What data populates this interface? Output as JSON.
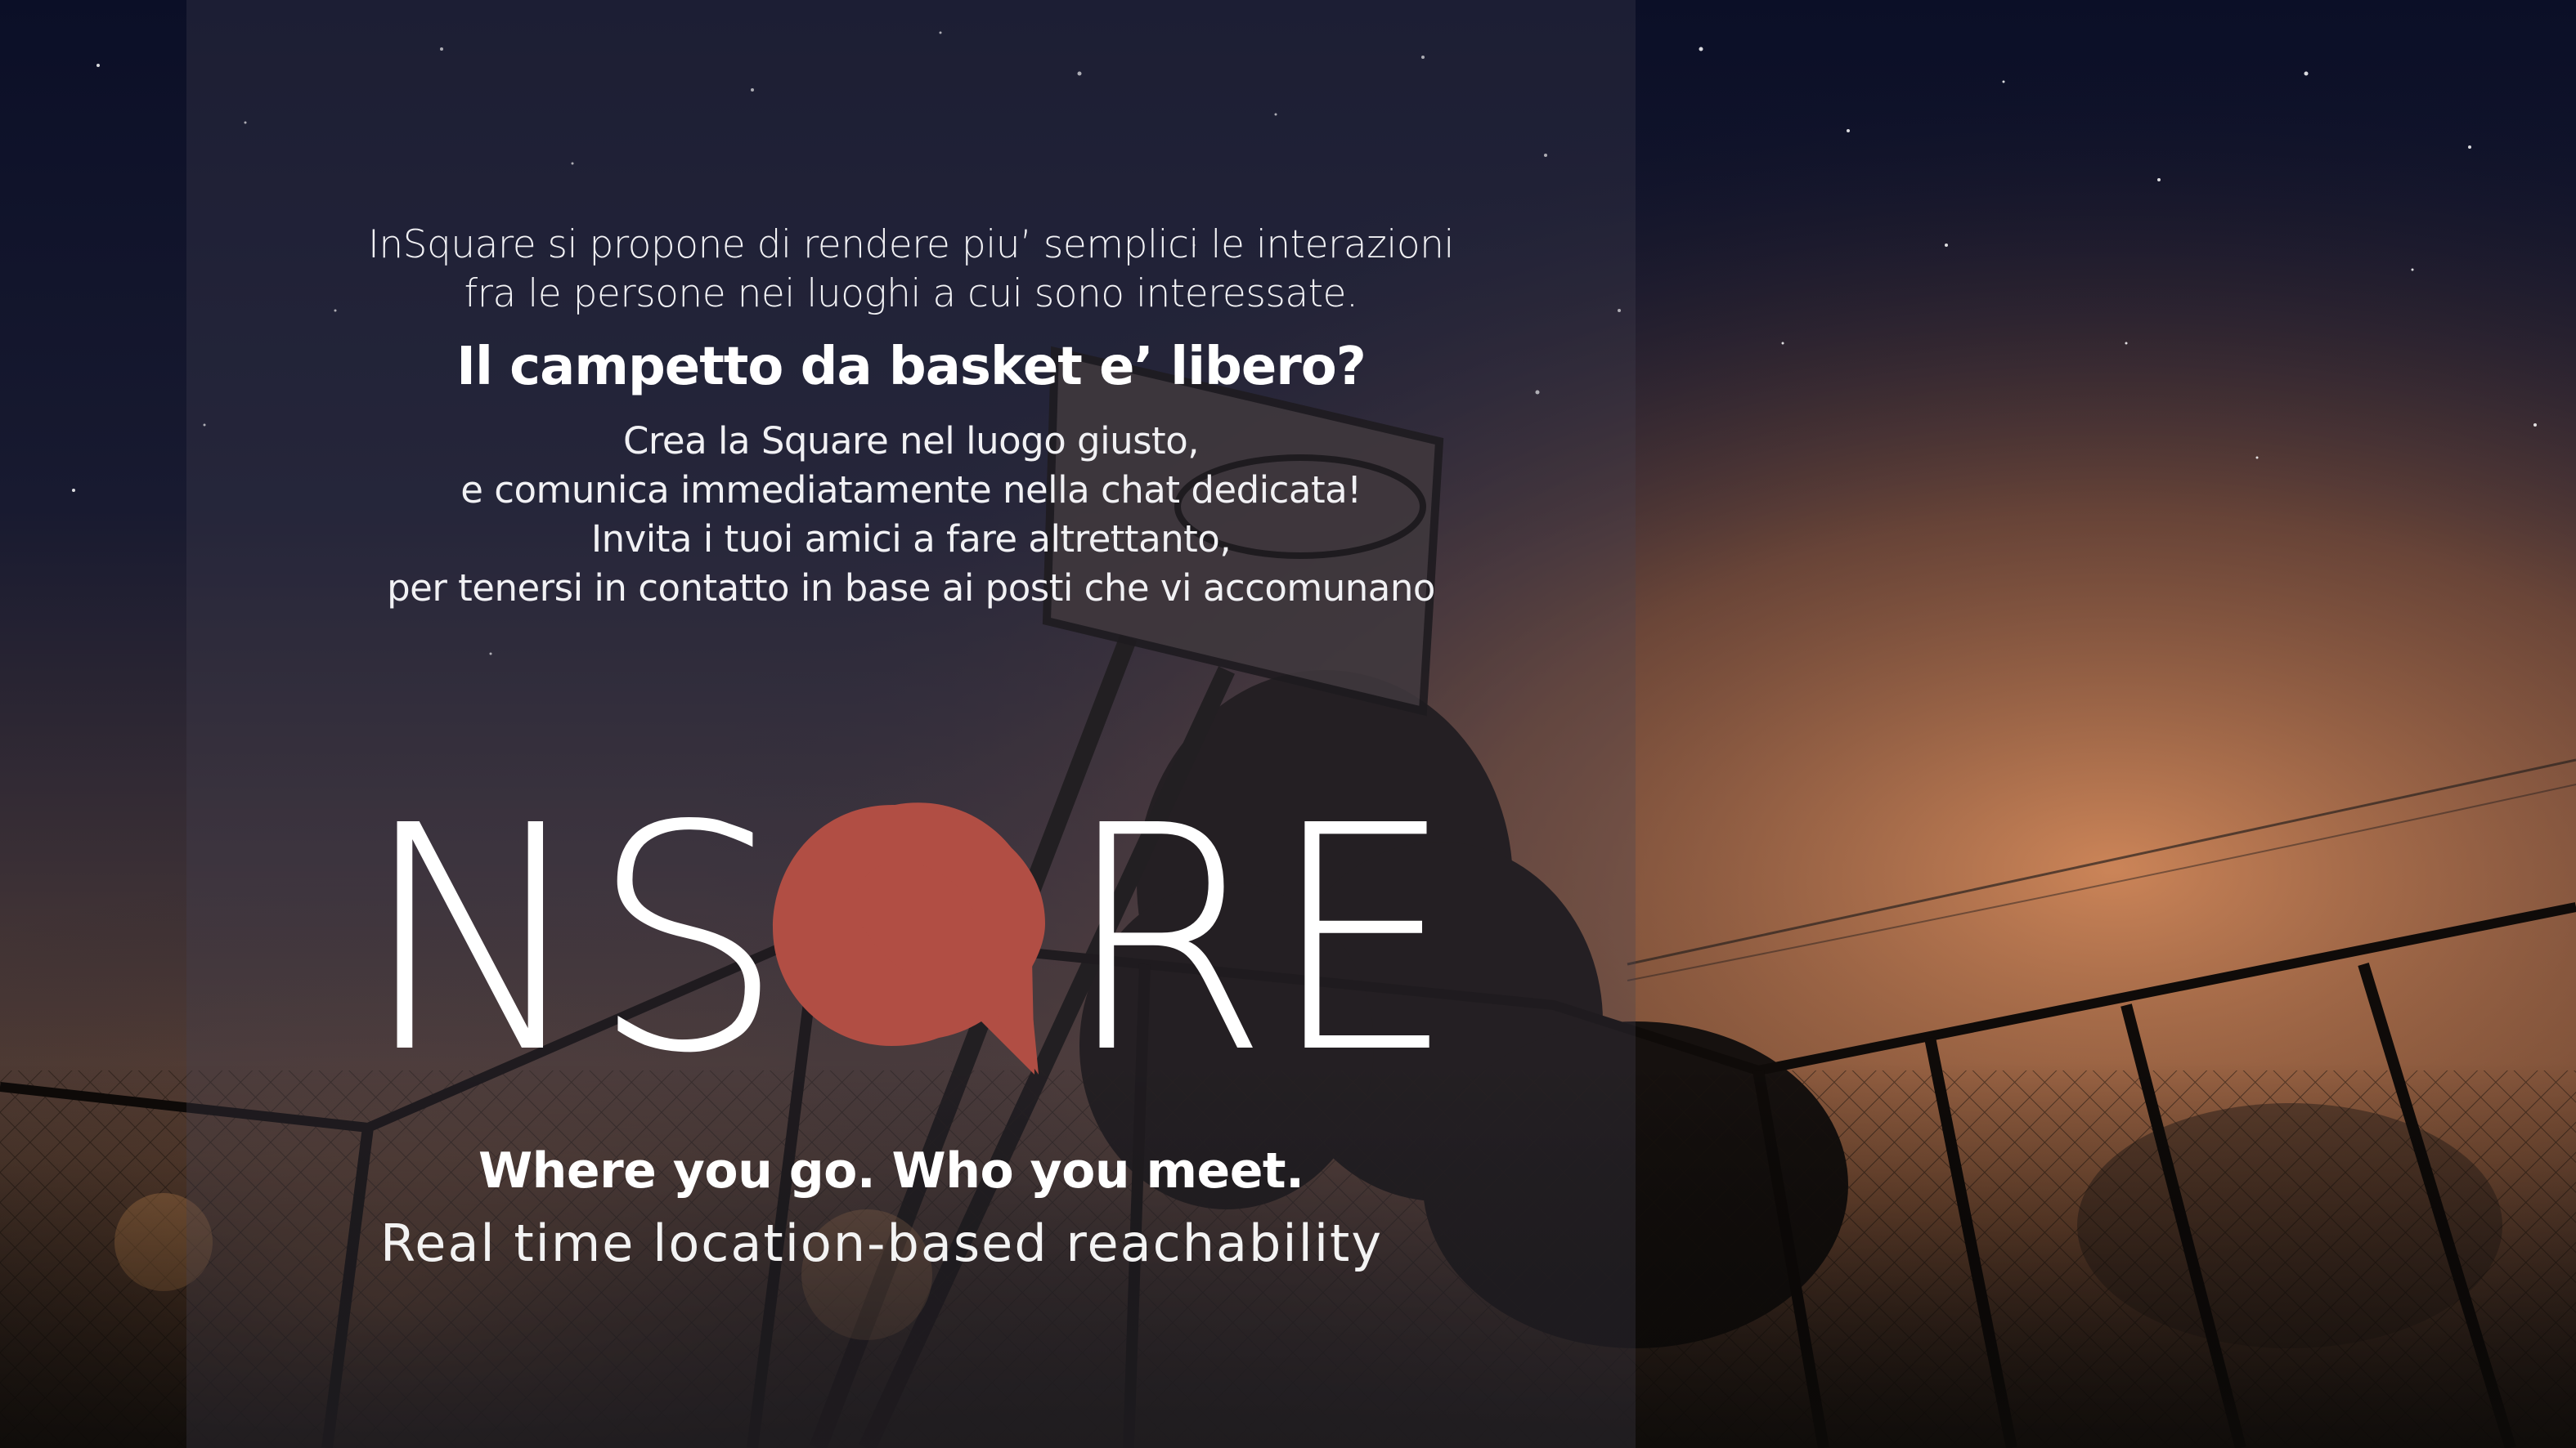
{
  "intro": {
    "line1": "InSquare si propone di rendere piu’ semplici le interazioni",
    "line2": "fra le persone nei luoghi a cui sono interessate."
  },
  "headline": "Il campetto da basket e’ libero?",
  "body": {
    "line1": "Crea la Square nel luogo giusto,",
    "line2": "e comunica immediatamente nella chat dedicata!",
    "line3": "Invita i tuoi amici a fare altrettanto,",
    "line4": "per tenersi in contatto in base ai posti che vi accomunano"
  },
  "logo": {
    "text_left": "NS",
    "text_right": "RE",
    "pin_color": "#b14e44"
  },
  "tagline": "Where you go. Who you meet.",
  "subtagline": "Real time location-based reachability",
  "colors": {
    "sky_dark": "#0c1024",
    "glow_orange": "#c07a48",
    "overlay": "#464252"
  }
}
